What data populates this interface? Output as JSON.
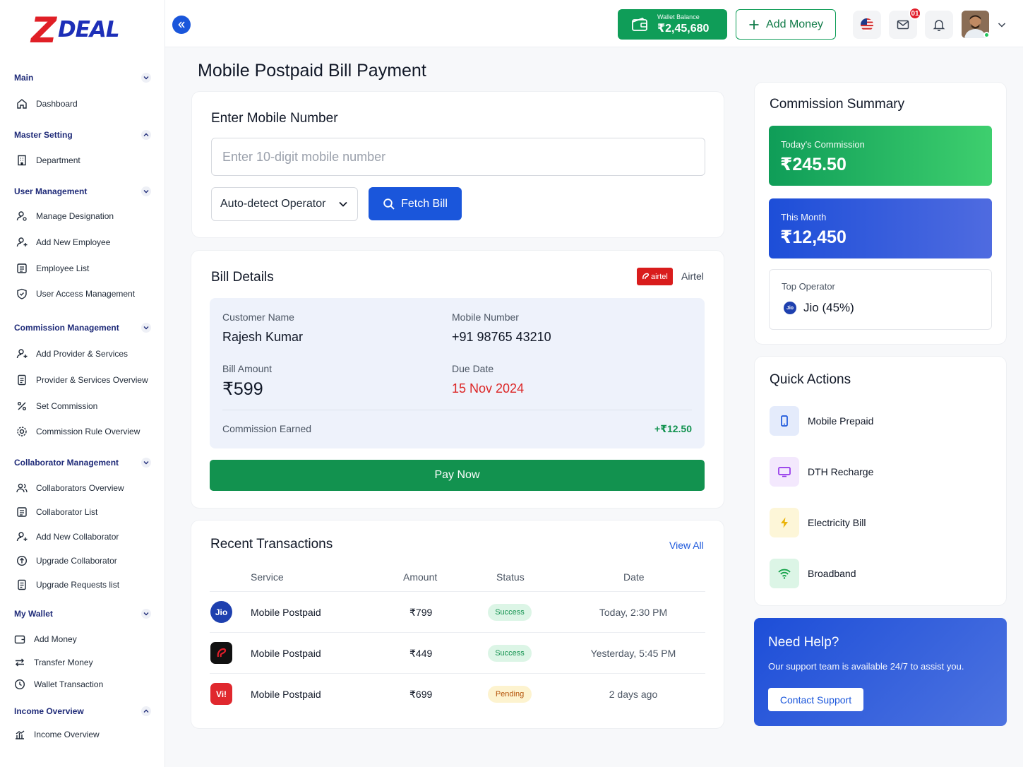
{
  "brand": {
    "logo_letter": "Z",
    "logo_rest": "DEAL",
    "logo_color": "#1d2fb8",
    "logo_accent": "#e01f26"
  },
  "sidebar": {
    "sections": [
      {
        "label": "Main",
        "items": [
          {
            "label": "Dashboard",
            "icon": "home-icon"
          }
        ]
      },
      {
        "label": "Master Setting",
        "items": [
          {
            "label": "Department",
            "icon": "building-icon"
          }
        ]
      },
      {
        "label": "User Management",
        "items": [
          {
            "label": "Manage Designation",
            "icon": "user-gear-icon"
          },
          {
            "label": "Add New Employee",
            "icon": "user-plus-icon"
          },
          {
            "label": "Employee List",
            "icon": "list-icon"
          },
          {
            "label": "User Access Management",
            "icon": "shield-icon"
          }
        ]
      },
      {
        "label": "Commission Management",
        "items": [
          {
            "label": "Add Provider & Services",
            "icon": "user-plus-icon"
          },
          {
            "label": "Provider & Services Overview",
            "icon": "document-icon"
          },
          {
            "label": "Set Commission",
            "icon": "percent-icon"
          },
          {
            "label": "Commission Rule Overview",
            "icon": "gear-icon"
          }
        ]
      },
      {
        "label": "Collaborator Management",
        "items": [
          {
            "label": "Collaborators Overview",
            "icon": "users-icon"
          },
          {
            "label": "Collaborator List",
            "icon": "list-icon"
          },
          {
            "label": "Add New Collaborator",
            "icon": "user-plus-icon"
          },
          {
            "label": "Upgrade Collaborator",
            "icon": "arrow-up-circle-icon"
          },
          {
            "label": "Upgrade Requests list",
            "icon": "document-icon"
          }
        ]
      },
      {
        "label": "My Wallet",
        "items": [
          {
            "label": "Add Money",
            "icon": "wallet-icon"
          },
          {
            "label": "Transfer Money",
            "icon": "transfer-icon"
          },
          {
            "label": "Wallet Transaction",
            "icon": "clock-icon"
          }
        ]
      },
      {
        "label": "Income Overview",
        "items": [
          {
            "label": "Income Overview",
            "icon": "chart-icon"
          }
        ]
      }
    ]
  },
  "topbar": {
    "wallet_label": "Wallet Balance",
    "wallet_value": "₹2,45,680",
    "add_money": "Add Money",
    "mail_badge": "01"
  },
  "page": {
    "title": "Mobile Postpaid Bill Payment"
  },
  "mobile_form": {
    "title": "Enter Mobile Number",
    "placeholder": "Enter 10-digit mobile number",
    "operator_selected": "Auto-detect Operator",
    "fetch_label": "Fetch Bill"
  },
  "bill": {
    "title": "Bill Details",
    "operator_logo": "airtel",
    "operator_name": "Airtel",
    "customer_label": "Customer Name",
    "customer_value": "Rajesh Kumar",
    "mobile_label": "Mobile Number",
    "mobile_value": "+91 98765 43210",
    "amount_label": "Bill Amount",
    "amount_value": "₹599",
    "due_label": "Due Date",
    "due_value": "15 Nov 2024",
    "commission_label": "Commission Earned",
    "commission_value": "+₹12.50",
    "pay_label": "Pay Now"
  },
  "transactions": {
    "title": "Recent Transactions",
    "view_all": "View All",
    "headers": [
      "Service",
      "Amount",
      "Status",
      "Date"
    ],
    "rows": [
      {
        "logo": "Jio",
        "service": "Mobile Postpaid",
        "amount": "₹799",
        "status": "Success",
        "date": "Today, 2:30 PM"
      },
      {
        "logo": "airtel",
        "service": "Mobile Postpaid",
        "amount": "₹449",
        "status": "Success",
        "date": "Yesterday, 5:45 PM"
      },
      {
        "logo": "Vi!",
        "service": "Mobile Postpaid",
        "amount": "₹699",
        "status": "Pending",
        "date": "2 days ago"
      }
    ]
  },
  "commission": {
    "title": "Commission Summary",
    "today_label": "Today's Commission",
    "today_value": "₹245.50",
    "month_label": "This Month",
    "month_value": "₹12,450",
    "top_label": "Top Operator",
    "top_value": "Jio (45%)",
    "top_logo": "Jio"
  },
  "quick_actions": {
    "title": "Quick Actions",
    "items": [
      {
        "label": "Mobile Prepaid",
        "icon": "phone-icon"
      },
      {
        "label": "DTH Recharge",
        "icon": "tv-icon"
      },
      {
        "label": "Electricity Bill",
        "icon": "bolt-icon"
      },
      {
        "label": "Broadband",
        "icon": "wifi-icon"
      }
    ]
  },
  "help": {
    "title": "Need Help?",
    "desc": "Our support team is available 24/7 to assist you.",
    "button": "Contact Support"
  },
  "colors": {
    "primary": "#1a56db",
    "success": "#0f9d58",
    "danger": "#dc2626",
    "pending": "#b45309"
  }
}
